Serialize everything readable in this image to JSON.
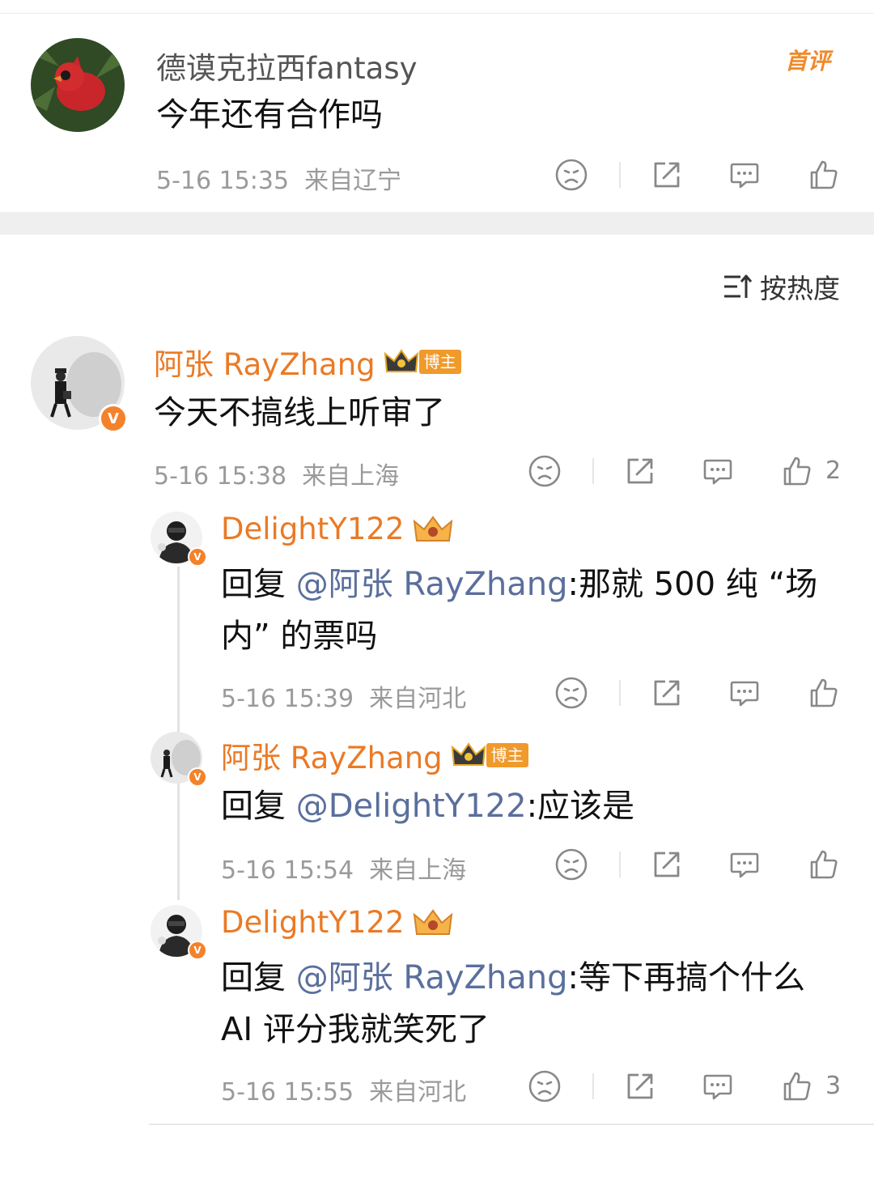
{
  "top_comment": {
    "username": "德谟克拉西fantasy",
    "text": "今年还有合作吗",
    "time": "5-16 15:35",
    "location": "来自辽宁",
    "badge": "首评"
  },
  "sort": {
    "label": "按热度"
  },
  "main_comment": {
    "username": "阿张 RayZhang",
    "tag": "博主",
    "text": "今天不搞线上听审了",
    "time": "5-16 15:38",
    "location": "来自上海",
    "likes": "2"
  },
  "replies": [
    {
      "username": "DelightY122",
      "reply_prefix": "回复",
      "mention": "@阿张 RayZhang",
      "text_line1": ":那就 500 纯 “场",
      "text_line2": "内” 的票吗",
      "time": "5-16 15:39",
      "location": "来自河北",
      "likes": ""
    },
    {
      "username": "阿张 RayZhang",
      "tag": "博主",
      "reply_prefix": "回复",
      "mention": "@DelightY122",
      "text_line1": ":应该是",
      "time": "5-16 15:54",
      "location": "来自上海",
      "likes": ""
    },
    {
      "username": "DelightY122",
      "reply_prefix": "回复",
      "mention": "@阿张 RayZhang",
      "text_line1": ":等下再搞个什么",
      "text_line2": "AI 评分我就笑死了",
      "time": "5-16 15:55",
      "location": "来自河北",
      "likes": "3"
    }
  ],
  "colors": {
    "accent_orange": "#ea7a26",
    "mention_blue": "#5a6f9c",
    "verified": "#f4822a"
  },
  "icons": [
    "dislike-face-icon",
    "share-icon",
    "comment-icon",
    "thumbs-up-icon",
    "sort-icon",
    "crown-icon"
  ]
}
